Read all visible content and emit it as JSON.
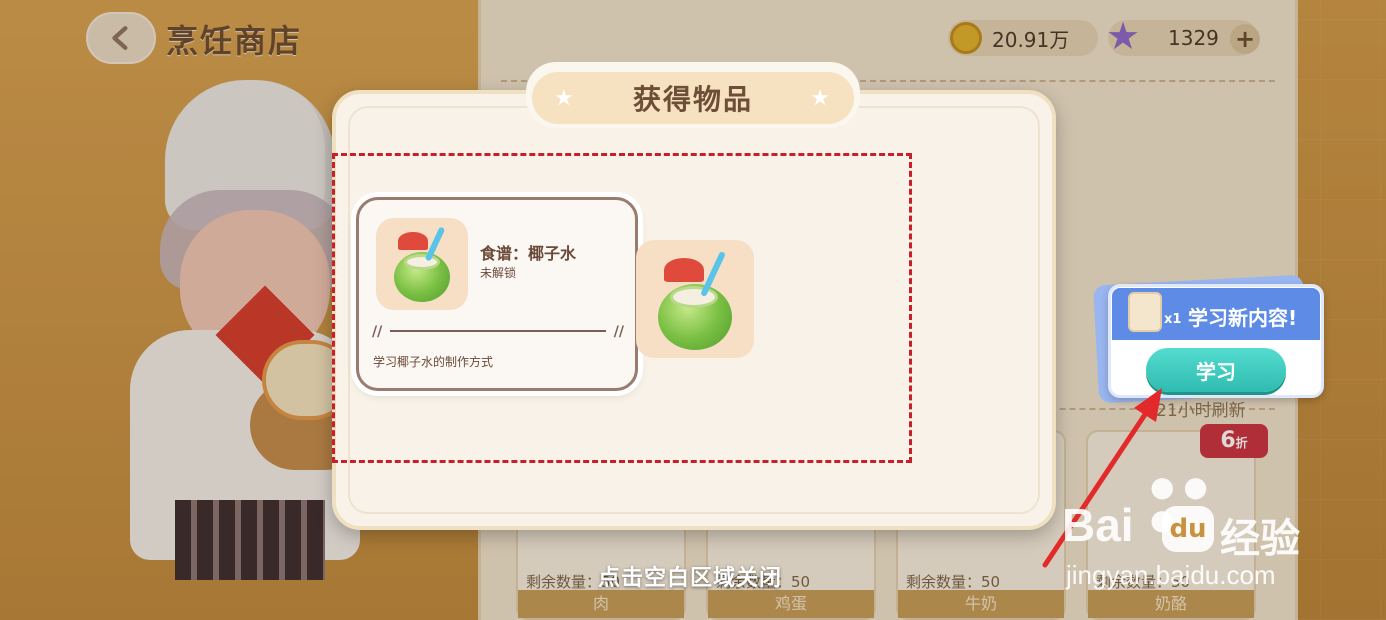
{
  "header": {
    "title": "烹饪商店",
    "back_icon": "chevron-left-icon"
  },
  "currency": {
    "coins": "20.91万",
    "stars": "1329",
    "plus": "+"
  },
  "shop": {
    "refresh_text": "21小时刷新",
    "discount": "6",
    "discount_unit": "折",
    "items": [
      {
        "stock_label": "剩余数量：50",
        "name": "肉"
      },
      {
        "stock_label": "剩余数量：50",
        "name": "鸡蛋"
      },
      {
        "stock_label": "剩余数量：50",
        "name": "牛奶"
      },
      {
        "stock_label": "剩余数量：50",
        "name": "奶酪"
      }
    ]
  },
  "dialog": {
    "title": "获得物品",
    "recipe_name": "食谱：椰子水",
    "recipe_status": "未解锁",
    "recipe_desc": "学习椰子水的制作方式",
    "tap_close": "点击空白区域关闭"
  },
  "learn_popup": {
    "count": "x1",
    "title": "学习新内容!",
    "button": "学习"
  },
  "watermark": {
    "bai": "Bai",
    "du": "du",
    "jingyan": "经验",
    "url": "jingyan.baidu.com"
  },
  "colors": {
    "accent_teal": "#2fbcb0",
    "popup_blue": "#5d8be6",
    "annotation_red": "#c8202a"
  }
}
